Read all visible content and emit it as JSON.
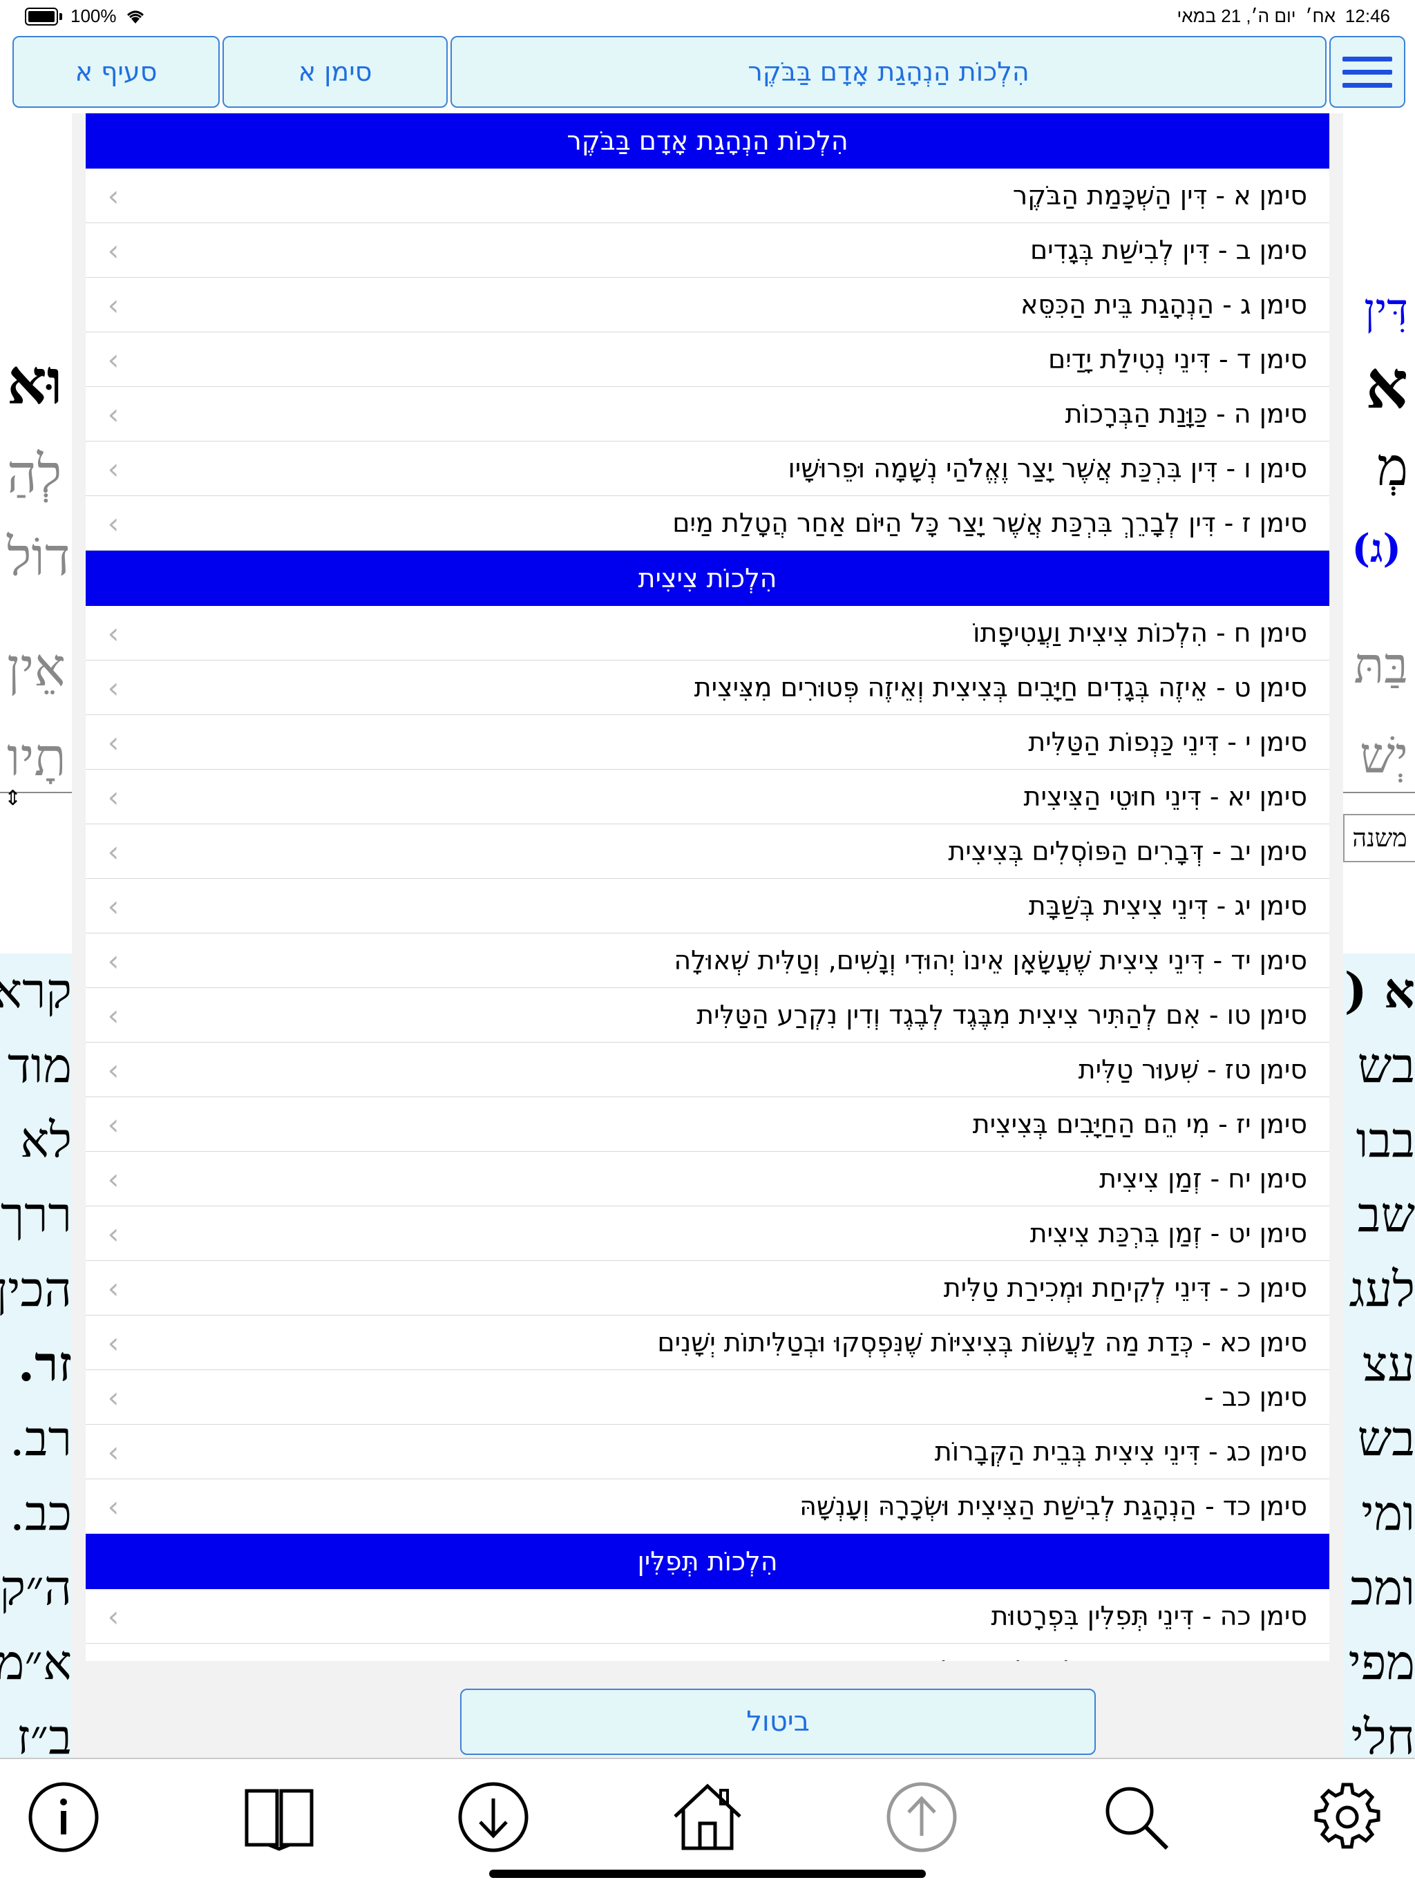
{
  "status": {
    "battery": "100%",
    "time": "12:46",
    "period": "אח׳",
    "date": "יום ה׳, 21 במאי"
  },
  "nav": {
    "seif": "סעיף א",
    "siman": "סימן א",
    "title": "הִלְכוֹת הַנְהָגַת אָדָם בַּבֹּקֶר"
  },
  "background": {
    "right_lines": [
      "דִּין",
      "א",
      "מְ",
      "(ג)",
      "בַּתּ",
      "יְשׁ"
    ],
    "left_lines": [
      "וּא",
      "לְהַ",
      "דוֹל",
      "אֵין",
      "תָיו"
    ],
    "lower_right": [
      "א (",
      "בש",
      "בבו",
      "שב",
      "לעג",
      "עצ",
      "בש",
      "ומי",
      "ומכ",
      "מפי",
      "חלי"
    ],
    "lower_left": [
      "קרא",
      "מוד",
      "לא",
      "ררך",
      "הכין",
      "זר.",
      "רב.",
      "כב.",
      "ה״ק",
      "א״מ",
      "ב״ז"
    ],
    "tab": "משנה"
  },
  "sections": [
    {
      "header": "הִלְכוֹת הַנְהָגַת אָדָם בַּבֹּקֶר",
      "items": [
        "סימן א - דִּין הַשְׁכָּמַת הַבֹּקֶר",
        "סימן ב - דִּין לְבִישַׁת בְּגָדִים",
        "סימן ג - הַנְהָגַת בֵּית הַכִּסֵּא",
        "סימן ד - דִּינֵי נְטִילַת יָדַיִם",
        "סימן ה - כַּוָּנַת הַבְּרָכוֹת",
        "סימן ו - דִּין בִּרְכַּת אֲשֶׁר יָצַר וֶאֱלֹהַי נְשָׁמָה וּפֵרוּשָׁיו",
        "סימן ז - דִּין לְבָרֵךְ בִּרְכַּת אֲשֶׁר יָצַר כָּל הַיּוֹם אַחַר הֲטָלַת מַיִם"
      ]
    },
    {
      "header": "הִלְכוֹת צִיצִית",
      "items": [
        "סימן ח - הִלְכוֹת צִיצִית וַעֲטִיפָתוֹ",
        "סימן ט - אֵיזֶה בְּגָדִים חַיָּבִים בְּצִיצִית וְאֵיזֶה פְּטוּרִים מִצִּיצִית",
        "סימן י - דִּינֵי כַּנְפוֹת הַטַּלִּית",
        "סימן יא - דִּינֵי חוּטֵי הַצִּיצִית",
        "סימן יב - דְּבָרִים הַפּוֹסְלִים בְּצִיצִית",
        "סימן יג - דִּינֵי צִיצִית בְּשַׁבָּת",
        "סימן יד - דִּינֵי צִיצִית שֶׁעֲשָׂאָן אֵינוֹ יְהוּדִי וְנָשִׁים, וְטַלִּית שְׁאוּלָה",
        "סימן טו - אִם לְהַתִּיר צִיצִית מִבֶּגֶד לְבֶגֶד וְדִין נִקְרַע הַטַּלִּית",
        "סימן טז - שִׁעוּר טַלִּית",
        "סימן יז - מִי הֵם הַחַיָּבִים בְּצִיצִית",
        "סימן יח - זְמַן צִיצִית",
        "סימן יט - זְמַן בִּרְכַּת צִיצִית",
        "סימן כ - דִּינֵי לְקִיחַת וּמְכִירַת טַלִּית",
        "סימן כא - כְּדַת מַה לַּעֲשׂוֹת בְּצִיצִיּוֹת שֶׁנִּפְסְקוּ וּבְטַלִּיתוֹת יְשָׁנִים",
        "סימן כב -",
        "סימן כג - דִּינֵי צִיצִית בְּבֵית הַקְּבָרוֹת",
        "סימן כד - הַנְהָגַת לְבִישַׁת הַצִּיצִית וּשְׂכָרָהּ וְעָנְשָׁהּ"
      ]
    },
    {
      "header": "הִלְכוֹת תְּפִלִּין",
      "items": [
        "סימן כה - דִּינֵי תְּפִלִּין בִּפְרָטוּת",
        "סימן כו - דִּין מִי שֶׁאֵין לוֹ אֶלָּא תְּפִלָּה אַחַת"
      ]
    }
  ],
  "cancel_label": "ביטול",
  "icons": {
    "row_chevron": "‹",
    "toolbar": [
      "info-icon",
      "book-icon",
      "arrow-down-icon",
      "home-icon",
      "arrow-up-icon",
      "search-icon",
      "gear-icon"
    ]
  },
  "colors": {
    "section_header": "#0000ee",
    "accent_blue": "#1f6fe0",
    "button_bg": "#e3f6f8"
  }
}
